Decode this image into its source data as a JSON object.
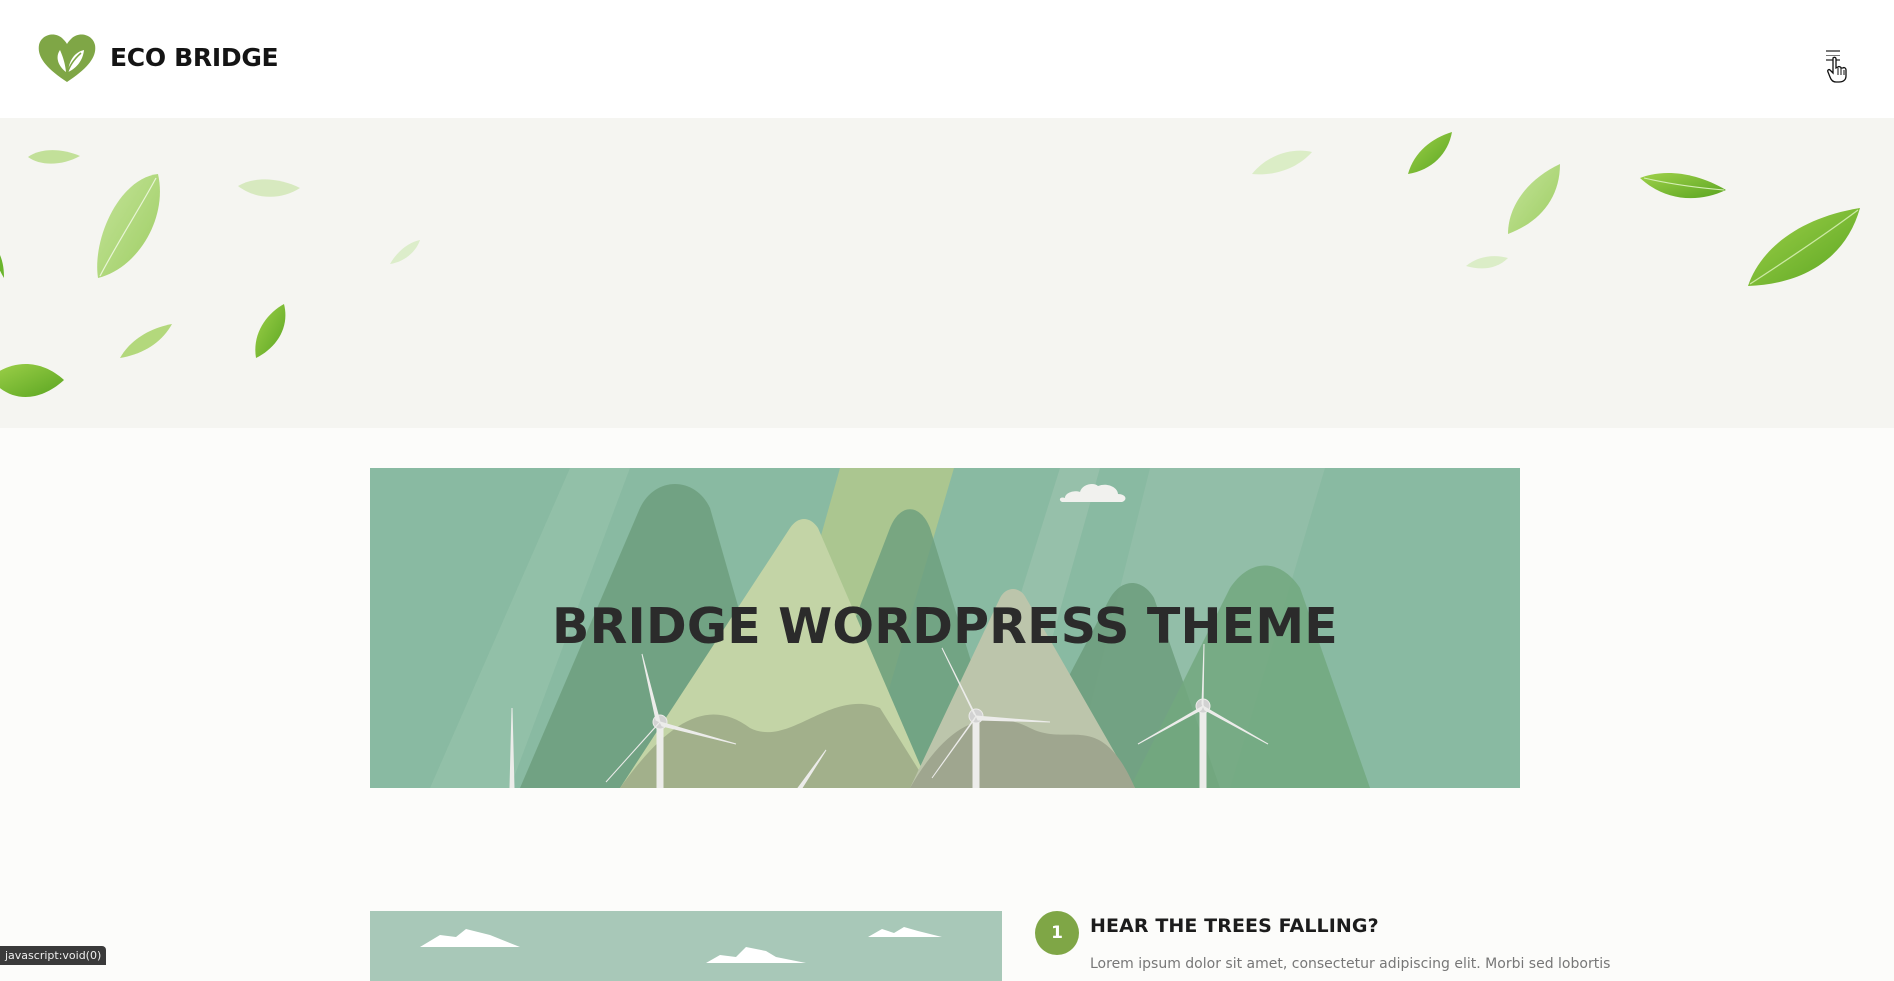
{
  "header": {
    "brand": "ECO BRIDGE",
    "menu_icon": "hamburger-menu-icon",
    "logo_icon": "heart-leaf-logo-icon"
  },
  "hero": {
    "title": "BRIDGE WORDPRESS THEME"
  },
  "steps": [
    {
      "number": "1",
      "title": "HEAR THE TREES FALLING?",
      "text": "Lorem ipsum dolor sit amet, consectetur adipiscing elit. Morbi sed lobortis"
    }
  ],
  "status_bar": {
    "text": "javascript:void(0)"
  },
  "colors": {
    "brand_green": "#7fa646",
    "hero_bg": "#89baa2",
    "band_bg": "#f5f5f1"
  }
}
